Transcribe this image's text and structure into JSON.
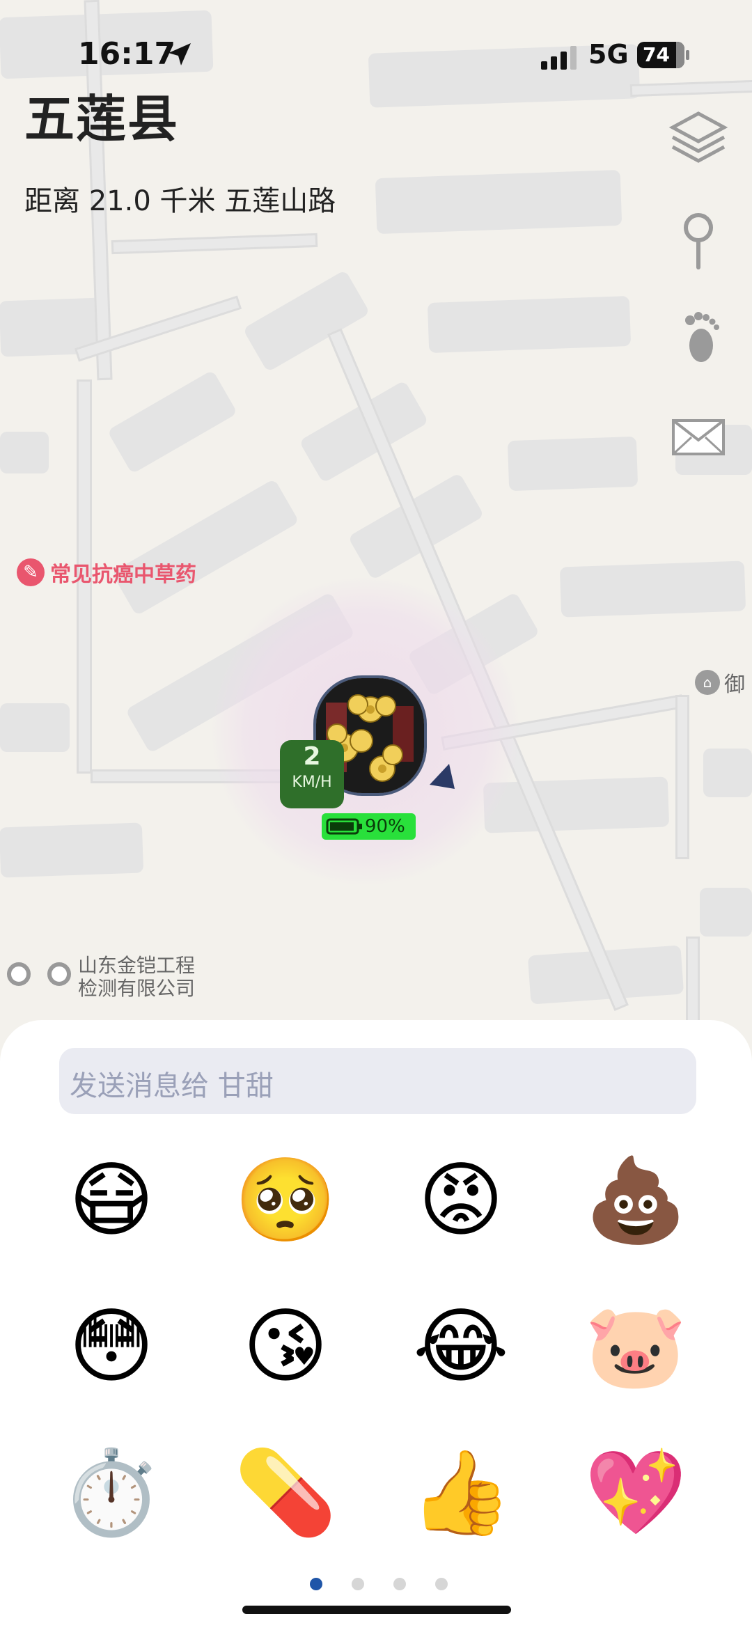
{
  "status_bar": {
    "time": "16:17",
    "network": "5G",
    "battery": "74"
  },
  "header": {
    "place": "五莲县",
    "distance_info": "距离 21.0 千米 五莲山路"
  },
  "toolbar": {
    "icons": [
      "layers-icon",
      "location-pin-icon",
      "footprints-icon",
      "mail-icon"
    ]
  },
  "map": {
    "poi_herb": {
      "icon": "pill-icon",
      "label": "常见抗癌中草药"
    },
    "poi_edge": {
      "icon": "house-icon",
      "label": "御"
    },
    "company_label": [
      "山东金铠工程",
      "检测有限公司"
    ],
    "user_marker": {
      "speed": "2",
      "speed_unit": "KM/H",
      "battery": "90%"
    }
  },
  "message_panel": {
    "placeholder": "发送消息给 甘甜",
    "emojis": [
      "😷",
      "🥺",
      "😡",
      "💩",
      "😳",
      "😘",
      "😂",
      "🐷",
      "⏱️",
      "💊",
      "👍",
      "💖"
    ],
    "page_indicator": {
      "pages": 4,
      "current": 1
    },
    "colors": {
      "active_dot": "#1f55a8",
      "inactive_dot": "#d6d6d6"
    }
  }
}
